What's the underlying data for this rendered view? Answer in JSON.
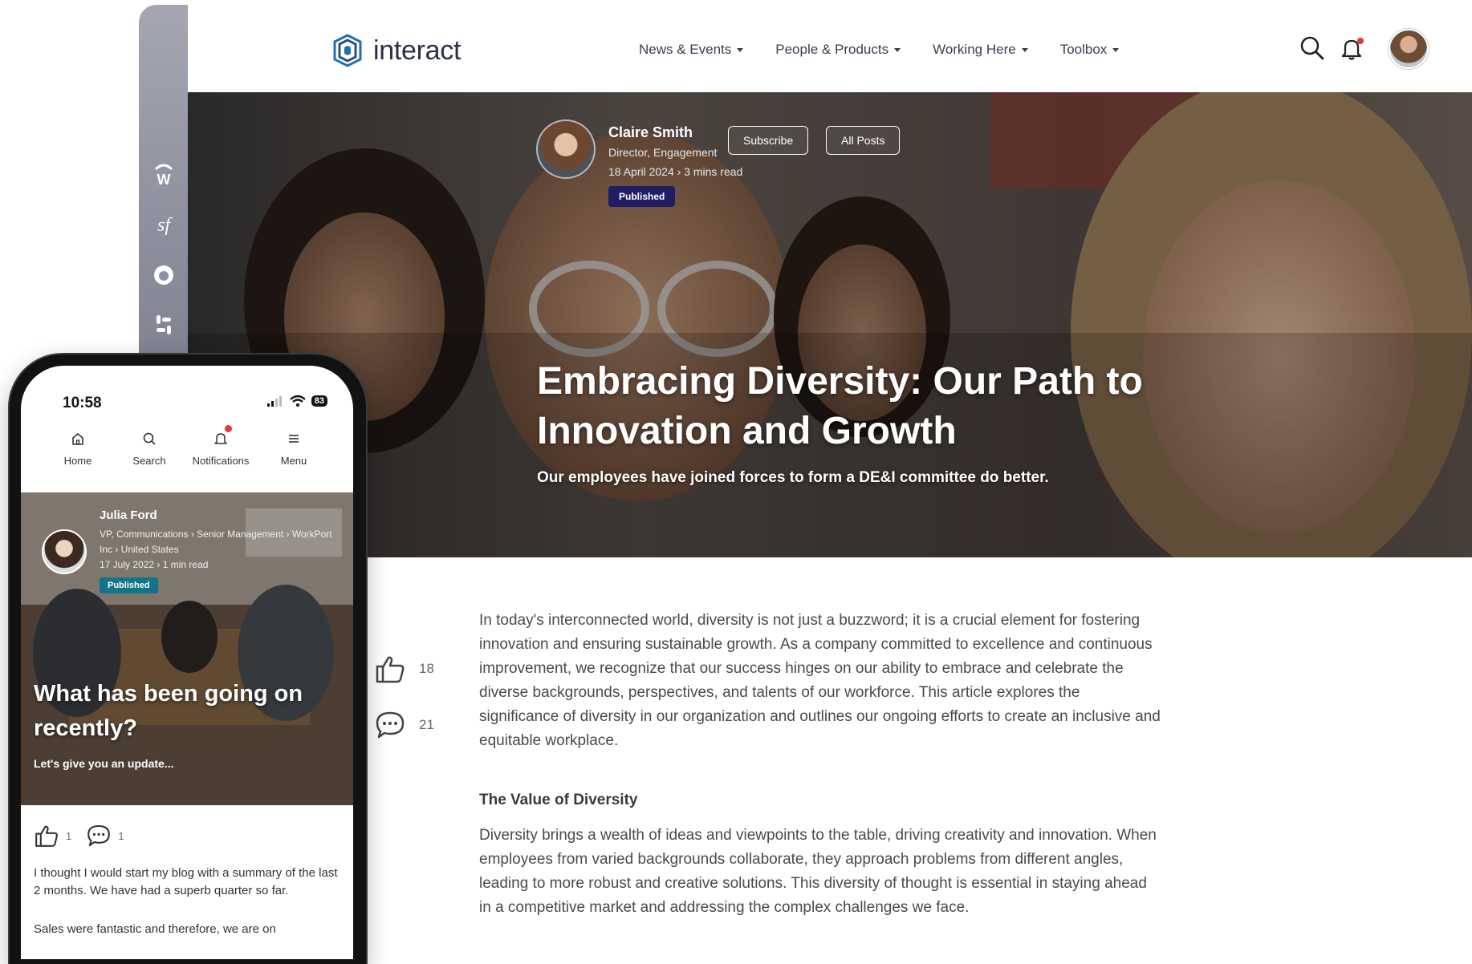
{
  "brand": {
    "name": "interact",
    "accent": "#1e6fb8"
  },
  "nav": {
    "items": [
      "News & Events",
      "People & Products",
      "Working Here",
      "Toolbox"
    ]
  },
  "rail": {
    "icons": [
      "workday-icon",
      "salesforce-icon",
      "app-icon",
      "slack-icon"
    ]
  },
  "hero": {
    "author_name": "Claire Smith",
    "author_role": "Director, Engagement",
    "date": "18 April 2024",
    "read_time": "3 mins read",
    "status": "Published",
    "subscribe_label": "Subscribe",
    "all_posts_label": "All Posts",
    "title": "Embracing Diversity: Our Path to Innovation and Growth",
    "subtitle": "Our employees have joined forces to form a DE&I committee do better."
  },
  "reactions": {
    "likes": "18",
    "comments": "21"
  },
  "article": {
    "intro": "In today's interconnected world, diversity is not just a buzzword; it is a crucial element for fostering innovation and ensuring sustainable growth. As a company committed to excellence and continuous improvement, we recognize that our success hinges on our ability to embrace and celebrate the diverse backgrounds, perspectives, and talents of our workforce. This article explores the significance of diversity in our organization and outlines our ongoing efforts to create an inclusive and equitable workplace.",
    "heading": "The Value of Diversity",
    "section_1": "Diversity brings a wealth of ideas and viewpoints to the table, driving creativity and innovation. When employees from varied backgrounds collaborate, they approach problems from different angles, leading to more robust and creative solutions. This diversity of thought is essential in staying ahead in a competitive market and addressing the complex challenges we face."
  },
  "phone": {
    "time": "10:58",
    "battery": "83",
    "nav": {
      "home": "Home",
      "search": "Search",
      "notifications": "Notifications",
      "menu": "Menu"
    },
    "author_name": "Julia Ford",
    "author_info": "VP, Communications › Senior Management › WorkPort Inc › United States",
    "date": "17 July 2022",
    "read_time": "1 min read",
    "status": "Published",
    "title": "What has been going on recently?",
    "subtitle": "Let's give you an update...",
    "likes": "1",
    "comments": "1",
    "body": "I thought I would start my blog with a summary of the last 2 months. We have had a superb quarter so far.",
    "body_2": "Sales were fantastic and therefore, we are on"
  }
}
